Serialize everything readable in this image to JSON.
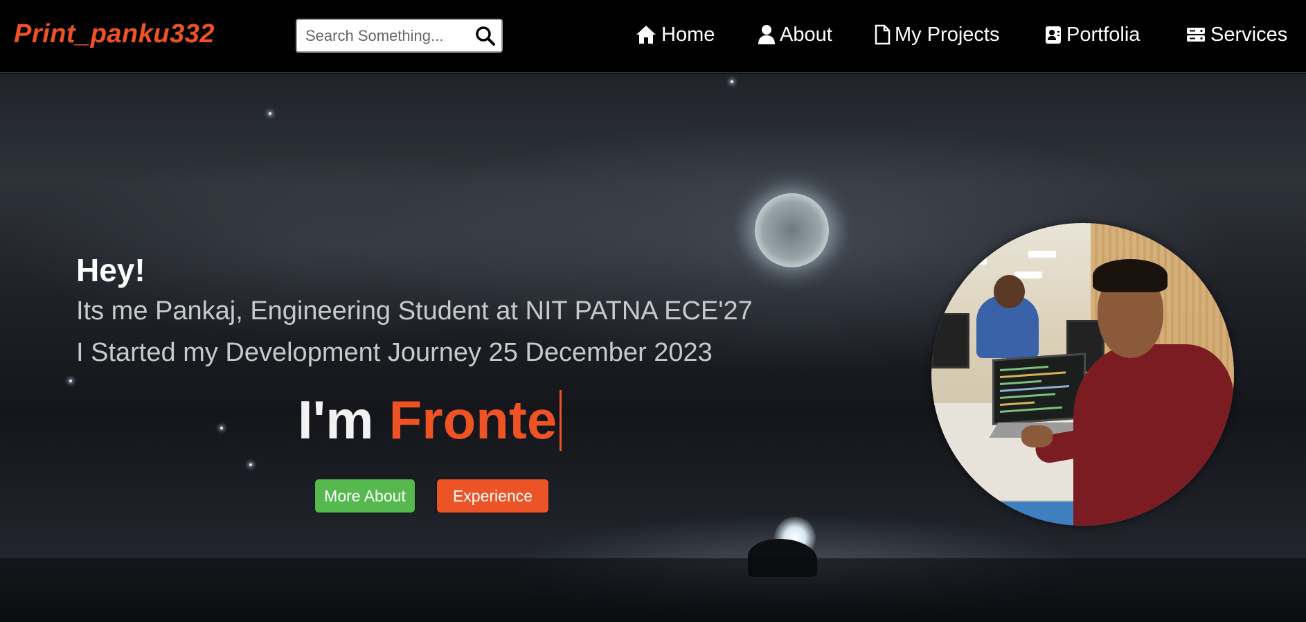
{
  "brand": {
    "title": "Print_panku332"
  },
  "search": {
    "placeholder": "Search Something..."
  },
  "nav": {
    "items": [
      {
        "label": "Home",
        "icon": "home-icon"
      },
      {
        "label": "About",
        "icon": "user-icon"
      },
      {
        "label": "My Projects",
        "icon": "file-icon"
      },
      {
        "label": "Portfolia",
        "icon": "id-badge-icon"
      },
      {
        "label": "Services",
        "icon": "server-icon"
      }
    ]
  },
  "hero": {
    "greeting": "Hey!",
    "intro_line1": "Its me Pankaj, Engineering Student at NIT PATNA ECE'27",
    "intro_line2": "I Started my Development Journey 25 December 2023",
    "typing_prefix": "I'm",
    "typing_role": "Fronte",
    "buttons": {
      "more_about": "More About",
      "experience": "Experience"
    }
  },
  "colors": {
    "accent": "#ef5223",
    "green_button": "#55b94e",
    "orange_button": "#ec5428",
    "navbar_bg": "#000000"
  }
}
